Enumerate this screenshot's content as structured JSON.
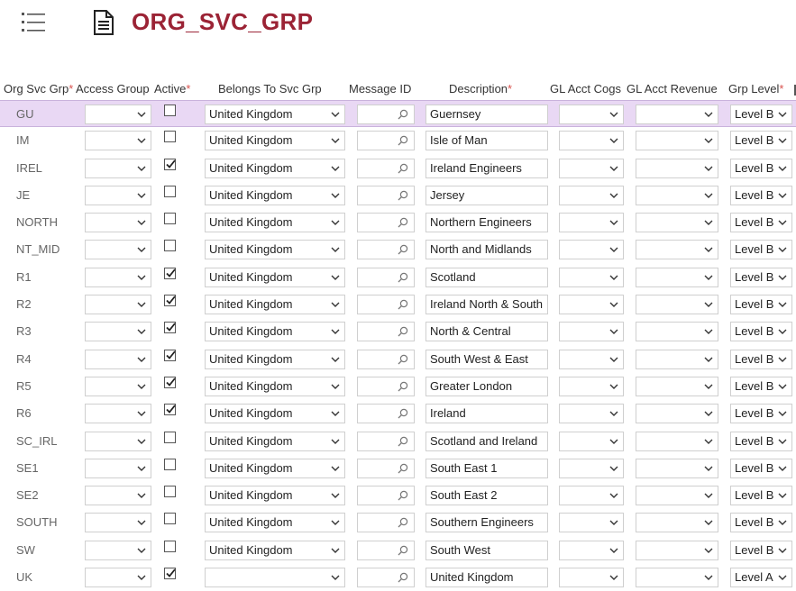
{
  "title": "ORG_SVC_GRP",
  "icons": {
    "menu": "list-menu-icon",
    "doc": "document-icon"
  },
  "columns": [
    {
      "label": "Org Svc Grp",
      "required": "*"
    },
    {
      "label": "Access Group",
      "required": ""
    },
    {
      "label": "Active",
      "required": "*"
    },
    {
      "label": "Belongs To Svc Grp",
      "required": ""
    },
    {
      "label": "Message ID",
      "required": ""
    },
    {
      "label": "Description",
      "required": "*"
    },
    {
      "label": "GL Acct Cogs",
      "required": ""
    },
    {
      "label": "GL Acct Revenue",
      "required": ""
    },
    {
      "label": "Grp Level",
      "required": "*"
    }
  ],
  "rows": [
    {
      "code": "GU",
      "active": false,
      "belongs": "United Kingdom",
      "desc": "Guernsey",
      "level": "Level B"
    },
    {
      "code": "IM",
      "active": false,
      "belongs": "United Kingdom",
      "desc": "Isle of Man",
      "level": "Level B"
    },
    {
      "code": "IREL",
      "active": true,
      "belongs": "United Kingdom",
      "desc": "Ireland Engineers",
      "level": "Level B"
    },
    {
      "code": "JE",
      "active": false,
      "belongs": "United Kingdom",
      "desc": "Jersey",
      "level": "Level B"
    },
    {
      "code": "NORTH",
      "active": false,
      "belongs": "United Kingdom",
      "desc": "Northern Engineers",
      "level": "Level B"
    },
    {
      "code": "NT_MID",
      "active": false,
      "belongs": "United Kingdom",
      "desc": "North and Midlands",
      "level": "Level B"
    },
    {
      "code": "R1",
      "active": true,
      "belongs": "United Kingdom",
      "desc": "Scotland",
      "level": "Level B"
    },
    {
      "code": "R2",
      "active": true,
      "belongs": "United Kingdom",
      "desc": "Ireland North & South",
      "level": "Level B"
    },
    {
      "code": "R3",
      "active": true,
      "belongs": "United Kingdom",
      "desc": "North & Central",
      "level": "Level B"
    },
    {
      "code": "R4",
      "active": true,
      "belongs": "United Kingdom",
      "desc": "South West & East",
      "level": "Level B"
    },
    {
      "code": "R5",
      "active": true,
      "belongs": "United Kingdom",
      "desc": "Greater London",
      "level": "Level B"
    },
    {
      "code": "R6",
      "active": true,
      "belongs": "United Kingdom",
      "desc": "Ireland",
      "level": "Level B"
    },
    {
      "code": "SC_IRL",
      "active": false,
      "belongs": "United Kingdom",
      "desc": "Scotland and Ireland",
      "level": "Level B"
    },
    {
      "code": "SE1",
      "active": false,
      "belongs": "United Kingdom",
      "desc": "South East 1",
      "level": "Level B"
    },
    {
      "code": "SE2",
      "active": false,
      "belongs": "United Kingdom",
      "desc": "South East 2",
      "level": "Level B"
    },
    {
      "code": "SOUTH",
      "active": false,
      "belongs": "United Kingdom",
      "desc": "Southern Engineers",
      "level": "Level B"
    },
    {
      "code": "SW",
      "active": false,
      "belongs": "United Kingdom",
      "desc": "South West",
      "level": "Level B"
    },
    {
      "code": "UK",
      "active": true,
      "belongs": "",
      "desc": "United Kingdom",
      "level": "Level A"
    }
  ],
  "selected_row": "GU",
  "colors": {
    "title": "#9b2335",
    "selected_row_bg": "#e9d8f4",
    "required_marker": "#d9534f"
  }
}
